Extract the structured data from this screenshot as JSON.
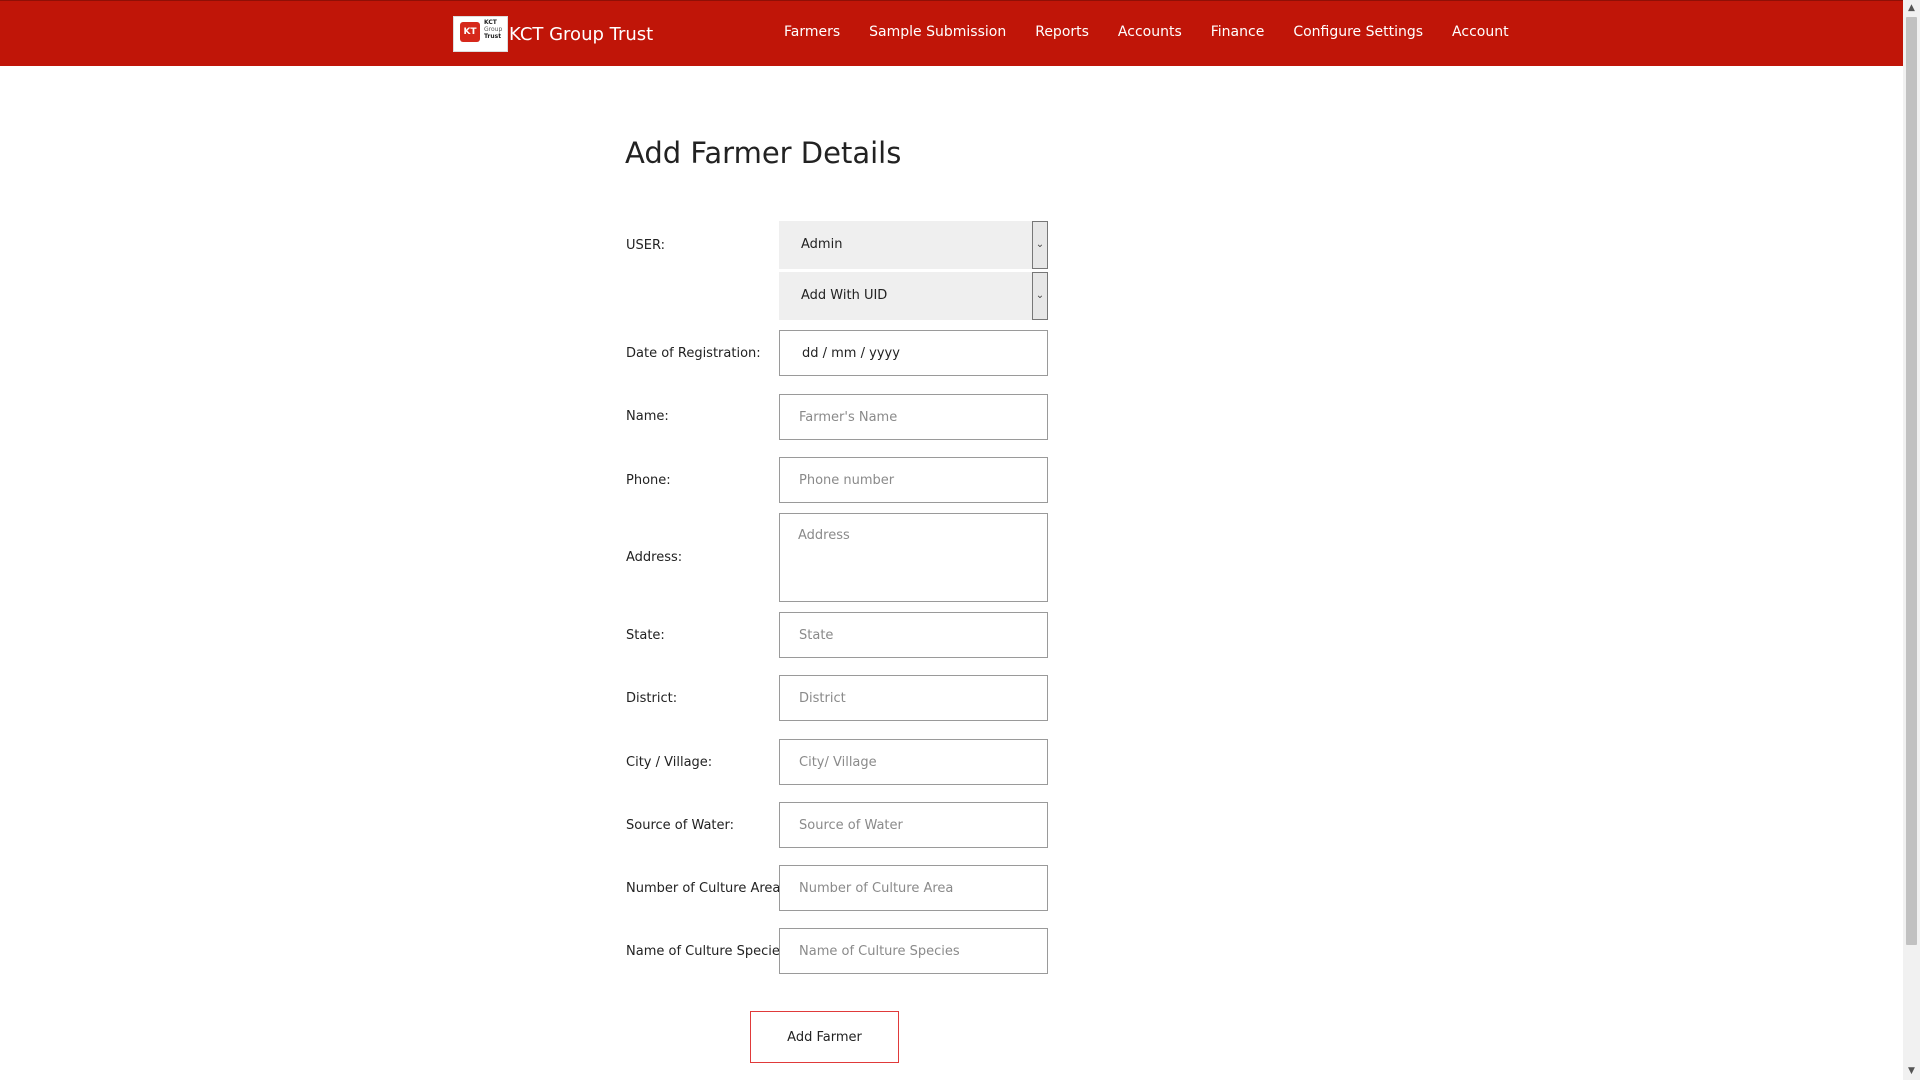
{
  "header": {
    "brand": "KCT Group Trust",
    "logo_text": [
      "KCT",
      "Group",
      "Trust"
    ],
    "nav": [
      "Farmers",
      "Sample Submission",
      "Reports",
      "Accounts",
      "Finance",
      "Configure Settings",
      "Account"
    ]
  },
  "form": {
    "title": "Add Farmer Details",
    "user_label": "USER:",
    "user_select": "Admin",
    "uid_select": "Add With UID",
    "date_label": "Date of Registration:",
    "date_value": "dd / mm / yyyy",
    "name_label": "Name:",
    "name_placeholder": "Farmer's Name",
    "phone_label": "Phone:",
    "phone_placeholder": "Phone number",
    "address_label": "Address:",
    "address_placeholder": "Address",
    "state_label": "State:",
    "state_placeholder": "State",
    "district_label": "District:",
    "district_placeholder": "District",
    "city_label": "City / Village:",
    "city_placeholder": "City/ Village",
    "water_label": "Source of Water:",
    "water_placeholder": "Source of Water",
    "area_label": "Number of Culture Area:",
    "area_placeholder": "Number of Culture Area",
    "species_label": "Name of Culture Species:",
    "species_placeholder": "Name of Culture Species",
    "submit_label": "Add Farmer"
  },
  "colors": {
    "header_bg": "#c01508",
    "button_border": "#e03a3a"
  }
}
